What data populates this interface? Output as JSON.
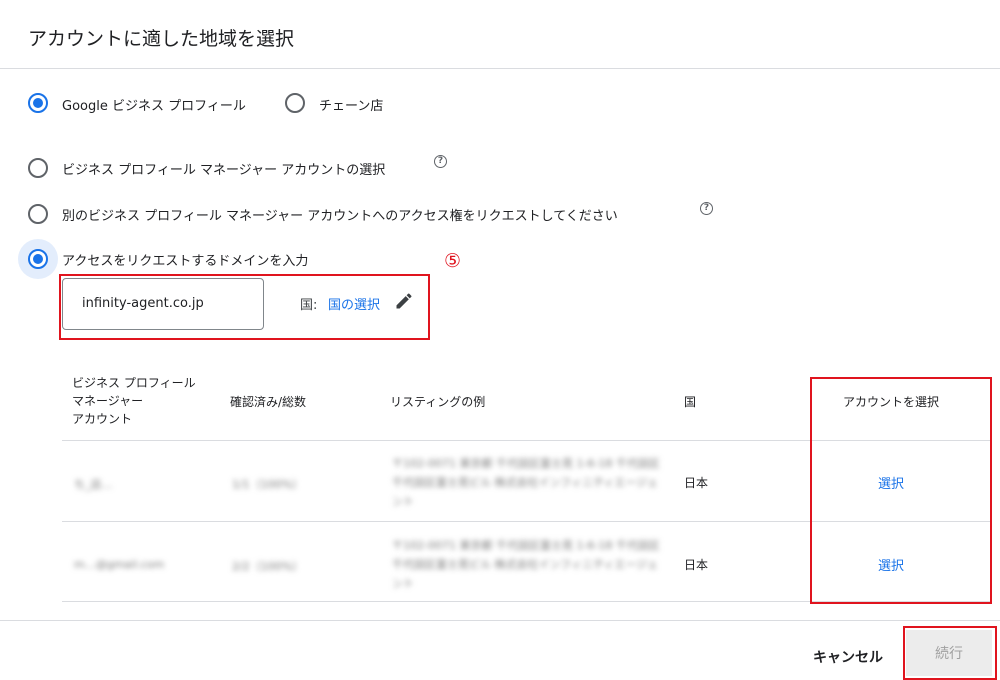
{
  "dialog": {
    "title": "アカウントに適した地域を選択"
  },
  "source_options": [
    {
      "label": "Google ビジネス プロフィール",
      "selected": true
    },
    {
      "label": "チェーン店",
      "selected": false
    }
  ],
  "account_options": [
    {
      "label": "ビジネス プロフィール マネージャー アカウントの選択",
      "selected": false,
      "help": "?"
    },
    {
      "label": "別のビジネス プロフィール マネージャー アカウントへのアクセス権をリクエストしてください",
      "selected": false,
      "help": "?"
    },
    {
      "label": "アクセスをリクエストするドメインを入力",
      "selected": true
    }
  ],
  "domain_input": {
    "value": "infinity-agent.co.jp"
  },
  "country": {
    "label": "国:",
    "link": "国の選択"
  },
  "annotation": {
    "number": "⑤"
  },
  "table": {
    "headers": {
      "account": [
        "ビジネス プロフィール",
        "マネージャー",
        "アカウント"
      ],
      "verified": "確認済み/総数",
      "listing": "リスティングの例",
      "country": "国",
      "select": "アカウントを選択"
    },
    "rows": [
      {
        "account": "ち_店…",
        "verified": "1/1（100%）",
        "listing": "〒102-0071 東京都 千代田区富士見 1-6-18 千代田区千代田区富士見ビル 株式会社インフィニティエージェント",
        "country": "日本",
        "action": "選択"
      },
      {
        "account": "m…@gmail.com",
        "verified": "2/2（100%）",
        "listing": "〒102-0071 東京都 千代田区富士見 1-6-18 千代田区千代田区富士見ビル 株式会社インフィニティエージェント",
        "country": "日本",
        "action": "選択"
      }
    ]
  },
  "footer": {
    "cancel": "キャンセル",
    "continue": "続行"
  },
  "colors": {
    "accent": "#1a73e8",
    "annotation": "#e0141e"
  }
}
